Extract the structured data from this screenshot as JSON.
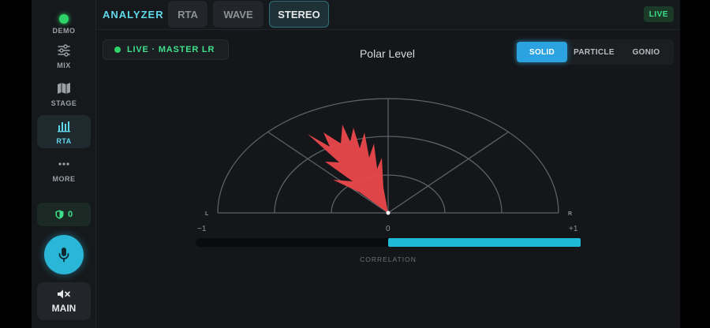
{
  "sidebar": {
    "demo_label": "DEMO",
    "mix_label": "MIX",
    "stage_label": "STAGE",
    "rta_label": "RTA",
    "more_label": "MORE",
    "shield_count": "0",
    "main_label": "MAIN"
  },
  "topbar": {
    "brand": "ANALYZER",
    "tabs": [
      "RTA",
      "WAVE",
      "STEREO"
    ],
    "active_tab": "STEREO",
    "live_badge": "LIVE"
  },
  "panel": {
    "status": "LIVE · MASTER LR",
    "title": "Polar Level",
    "modes": [
      "SOLID",
      "PARTICLE",
      "GONIO"
    ],
    "active_mode": "SOLID",
    "scope": {
      "left_label": "L",
      "right_label": "R",
      "scale_min": "−1",
      "scale_mid": "0",
      "scale_max": "+1",
      "correlation_label": "CORRELATION",
      "correlation_value": 1.0
    }
  },
  "colors": {
    "accent": "#5fd8ec",
    "live_green": "#3fe08d",
    "mode_active": "#2aa3e0",
    "correlation_bar": "#1fb8d6",
    "polar_fill": "#e8474a"
  }
}
